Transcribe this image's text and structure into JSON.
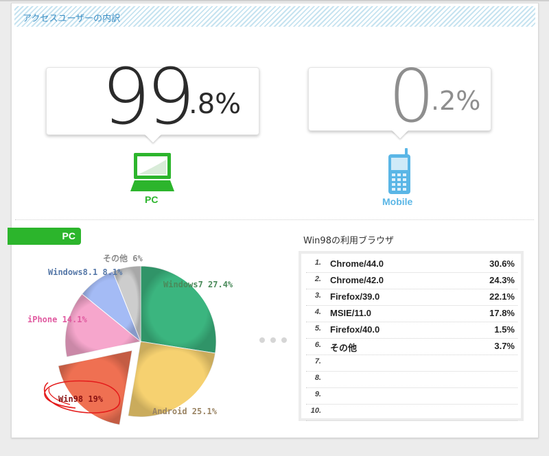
{
  "panel": {
    "title": "アクセスユーザーの内訳"
  },
  "devices": {
    "pc": {
      "int": "99",
      "dec": ".8%",
      "label": "PC"
    },
    "mobile": {
      "int": "0",
      "dec": ".2%",
      "label": "Mobile"
    }
  },
  "section": {
    "tab_label": "PC"
  },
  "chart_data": {
    "type": "pie",
    "title": "",
    "slices": [
      {
        "label": "Windows7 27.4%",
        "value": 27.4,
        "color": "#3bb57f",
        "label_color": "#4a8a5a"
      },
      {
        "label": "Android 25.1%",
        "value": 25.1,
        "color": "#f6d170",
        "label_color": "#9a8464"
      },
      {
        "label": "Win98 19%",
        "value": 19.0,
        "color": "#ef7052",
        "label_color": "#8a1212",
        "exploded": true
      },
      {
        "label": "iPhone 14.1%",
        "value": 14.1,
        "color": "#f6a6cc",
        "label_color": "#e05aa0"
      },
      {
        "label": "Windows8.1 8.1%",
        "value": 8.1,
        "color": "#a4bbf5",
        "label_color": "#5678a8"
      },
      {
        "label": "その他 6%",
        "value": 6.0,
        "color": "#cdcdcd",
        "label_color": "#8a8a8a"
      }
    ],
    "annotation": {
      "color": "#e41b1b",
      "target": "Win98 19%"
    }
  },
  "browser_table": {
    "title": "Win98の利用ブラウザ",
    "rows": [
      {
        "num": "1.",
        "name": "Chrome/44.0",
        "pct": "30.6%"
      },
      {
        "num": "2.",
        "name": "Chrome/42.0",
        "pct": "24.3%"
      },
      {
        "num": "3.",
        "name": "Firefox/39.0",
        "pct": "22.1%"
      },
      {
        "num": "4.",
        "name": "MSIE/11.0",
        "pct": "17.8%"
      },
      {
        "num": "5.",
        "name": "Firefox/40.0",
        "pct": "1.5%"
      },
      {
        "num": "6.",
        "name": "その他",
        "pct": "3.7%"
      },
      {
        "num": "7.",
        "name": "",
        "pct": ""
      },
      {
        "num": "8.",
        "name": "",
        "pct": ""
      },
      {
        "num": "9.",
        "name": "",
        "pct": ""
      },
      {
        "num": "10.",
        "name": "",
        "pct": ""
      }
    ]
  },
  "colors": {
    "pc_green": "#2cb52c",
    "mobile_blue": "#5ab6e6",
    "header_blue": "#3a8ec4"
  }
}
